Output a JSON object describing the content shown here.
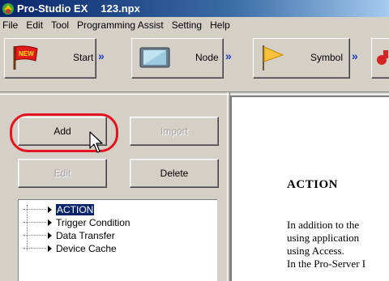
{
  "window": {
    "app_name": "Pro-Studio EX",
    "file_name": "123.npx",
    "icon": "pro-studio-app-icon"
  },
  "menu": [
    "File",
    "Edit",
    "Tool",
    "Programming Assist",
    "Setting",
    "Help"
  ],
  "toolbar": {
    "start_label": "Start",
    "node_label": "Node",
    "symbol_label": "Symbol",
    "new_badge": "NEW",
    "arrow": "»"
  },
  "buttons": {
    "add": "Add",
    "import": "Import",
    "edit": "Edit",
    "delete": "Delete"
  },
  "tree": {
    "items": [
      "ACTION",
      "Trigger Condition",
      "Data Transfer",
      "Device Cache"
    ],
    "selected_index": 0
  },
  "doc": {
    "title": "ACTION",
    "lines": [
      "In addition to the",
      "using application",
      "using Access.",
      "In the Pro-Server I"
    ]
  },
  "colors": {
    "highlight_ring": "#e3141e",
    "title_bar": "#0a246a",
    "selection": "#0a246a"
  }
}
